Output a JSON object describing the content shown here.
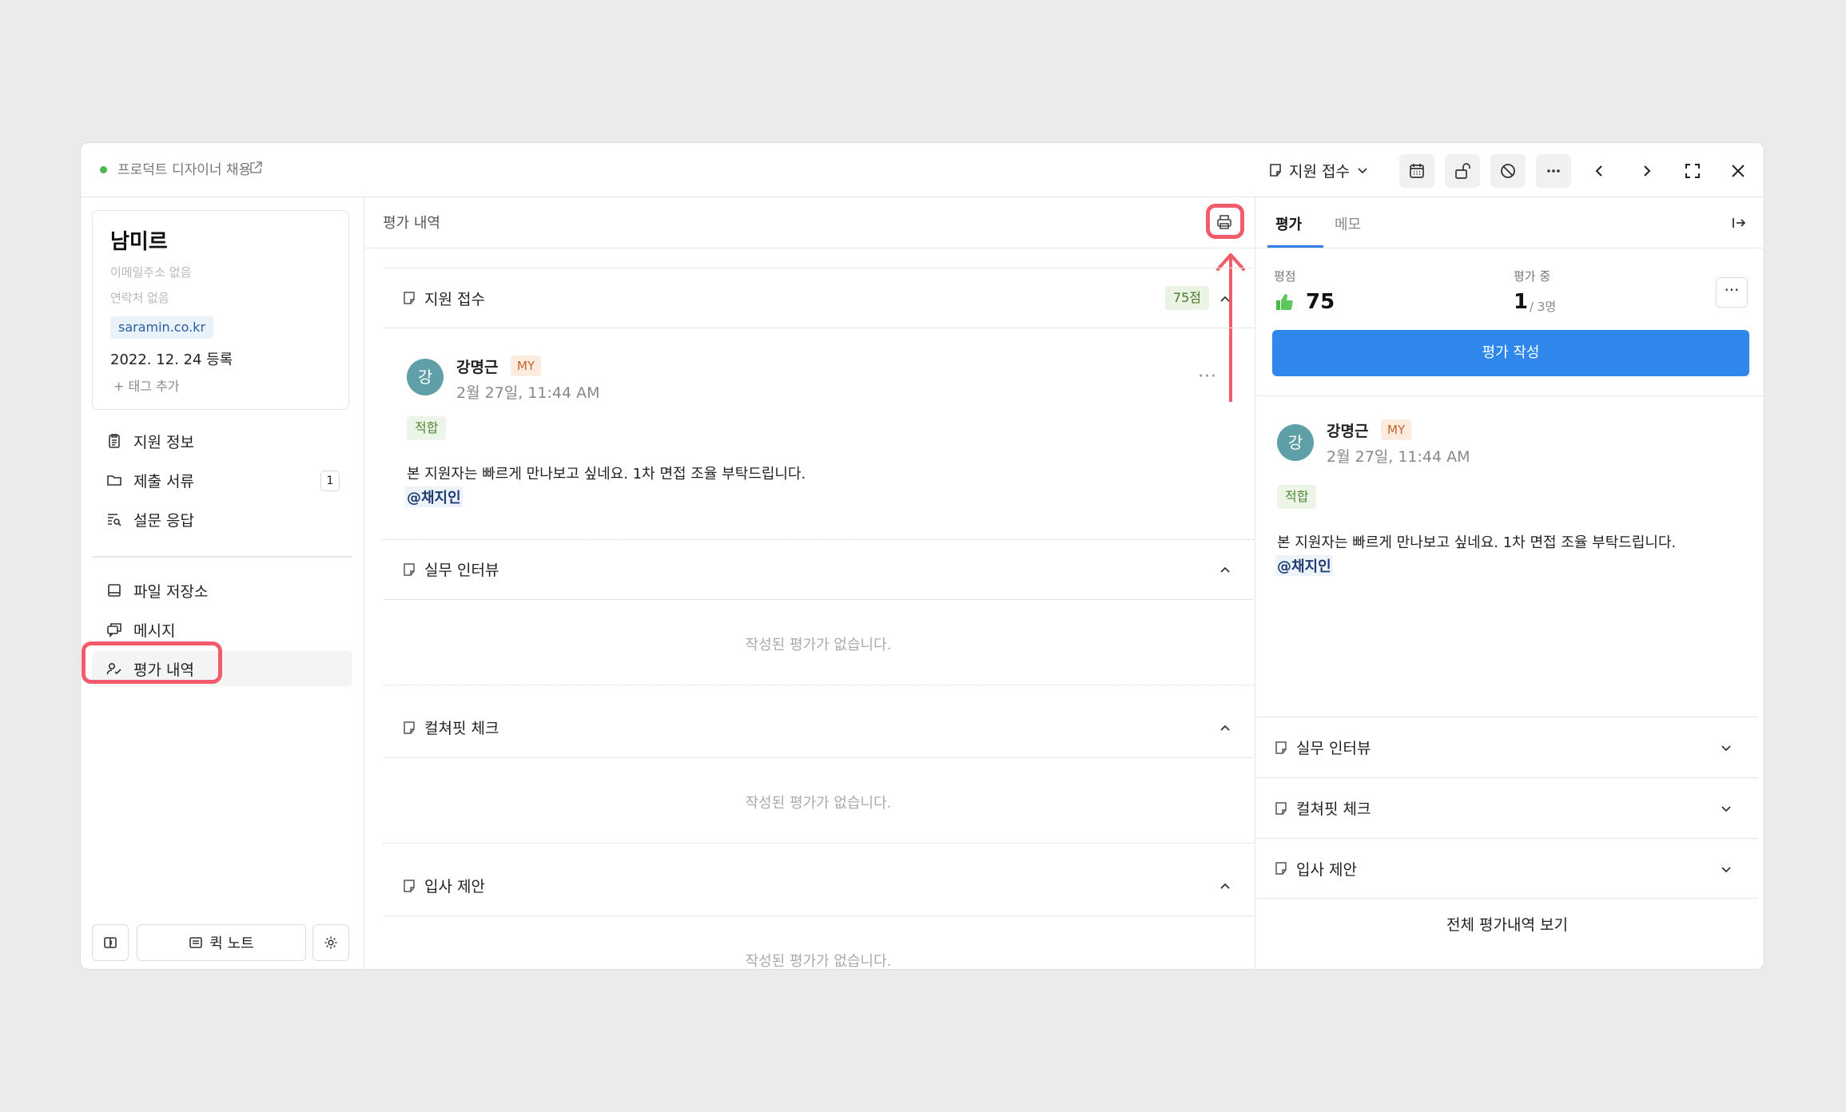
{
  "topbar": {
    "job_title": "프로덕트 디자이너 채용",
    "status_label": "지원 접수"
  },
  "profile": {
    "name": "남미르",
    "email": "이메일주소 없음",
    "phone": "연락처 없음",
    "source": "saramin.co.kr",
    "date": "2022. 12. 24",
    "date_suffix": "등록",
    "add_tag": "+ 태그 추가"
  },
  "nav": {
    "items": [
      {
        "label": "지원 정보"
      },
      {
        "label": "제출 서류",
        "badge": "1"
      },
      {
        "label": "설문 응답"
      },
      {
        "label": "파일 저장소"
      },
      {
        "label": "메시지"
      },
      {
        "label": "평가 내역"
      }
    ]
  },
  "bottom": {
    "quick_note": "퀵 노트"
  },
  "middle": {
    "title": "평가 내역",
    "sections": [
      {
        "title": "지원 접수",
        "score": "75점"
      },
      {
        "title": "실무 인터뷰"
      },
      {
        "title": "컬쳐핏 체크"
      },
      {
        "title": "입사 제안"
      }
    ],
    "empty_text": "작성된 평가가 없습니다.",
    "comment": {
      "avatar": "강",
      "author": "강명근",
      "tag": "MY",
      "time": "2월 27일, 11:44 AM",
      "verdict": "적합",
      "text": "본 지원자는 빠르게 만나보고 싶네요. 1차 면접 조율 부탁드립니다.",
      "mention": "@채지인"
    }
  },
  "right": {
    "tabs": [
      "평가",
      "메모"
    ],
    "score_label": "평점",
    "score_value": "75",
    "progress_label": "평가 중",
    "progress_value": "1",
    "progress_total": "/ 3명",
    "write_button": "평가 작성",
    "sections": [
      "실무 인터뷰",
      "컬쳐핏 체크",
      "입사 제안"
    ],
    "view_all": "전체 평가내역 보기"
  },
  "colors": {
    "accent": "#2f87ec",
    "highlight": "#f05c6a",
    "status_dot": "#4cb84c"
  }
}
